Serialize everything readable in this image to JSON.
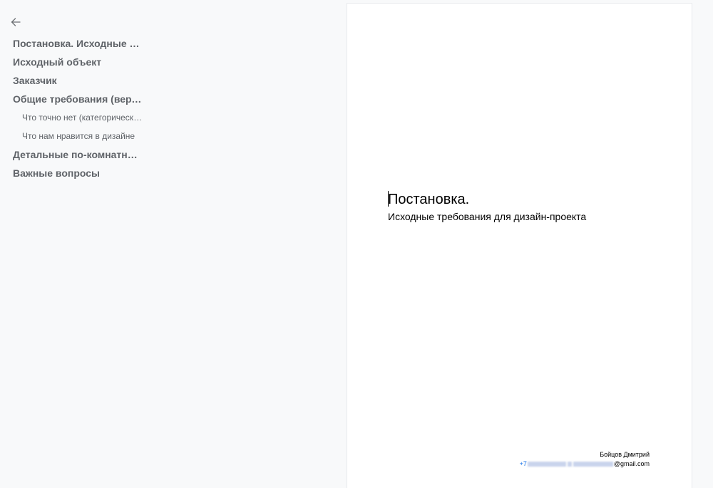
{
  "outline": {
    "back_icon": "arrow-left-icon",
    "items": [
      {
        "label": "Постановка. Исходные тре…",
        "level": 1
      },
      {
        "label": "Исходный объект",
        "level": 1
      },
      {
        "label": "Заказчик",
        "level": 1
      },
      {
        "label": "Общие требования (верхни…",
        "level": 1
      },
      {
        "label": "Что точно нет (категорическо…",
        "level": 2
      },
      {
        "label": "Что нам нравится в дизайне",
        "level": 2
      },
      {
        "label": "Детальные по-комнатные т…",
        "level": 1
      },
      {
        "label": "Важные вопросы",
        "level": 1
      }
    ]
  },
  "document": {
    "title": "Постановка.",
    "subtitle": "Исходные требования для дизайн-проекта",
    "footer": {
      "name": "Бойцов Дмитрий",
      "phone_prefix": "+7",
      "email_suffix": "@gmail.com"
    }
  }
}
